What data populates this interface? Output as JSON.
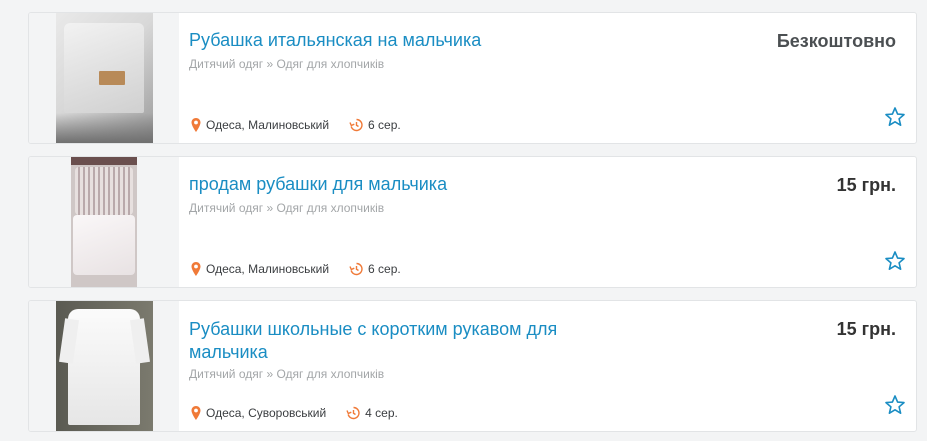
{
  "listings": [
    {
      "title": "Рубашка итальянская на мальчика",
      "category": "Дитячий одяг » Одяг для хлопчиків",
      "location": "Одеса, Малиновський",
      "date": "6 сер.",
      "price": "Безкоштовно"
    },
    {
      "title": "продам рубашки для мальчика",
      "category": "Дитячий одяг » Одяг для хлопчиків",
      "location": "Одеса, Малиновський",
      "date": "6 сер.",
      "price": "15 грн."
    },
    {
      "title": "Рубашки школьные с коротким рукавом для мальчика",
      "category": "Дитячий одяг » Одяг для хлопчиків",
      "location": "Одеса, Суворовський",
      "date": "4 сер.",
      "price": "15 грн."
    }
  ],
  "icons": {
    "location": "map-pin-icon",
    "date": "history-icon",
    "favorite": "star-outline-icon"
  },
  "colors": {
    "title": "#1a8dc3",
    "icon_orange": "#f07a38",
    "star": "#1a8dc3",
    "price": "#333333"
  }
}
